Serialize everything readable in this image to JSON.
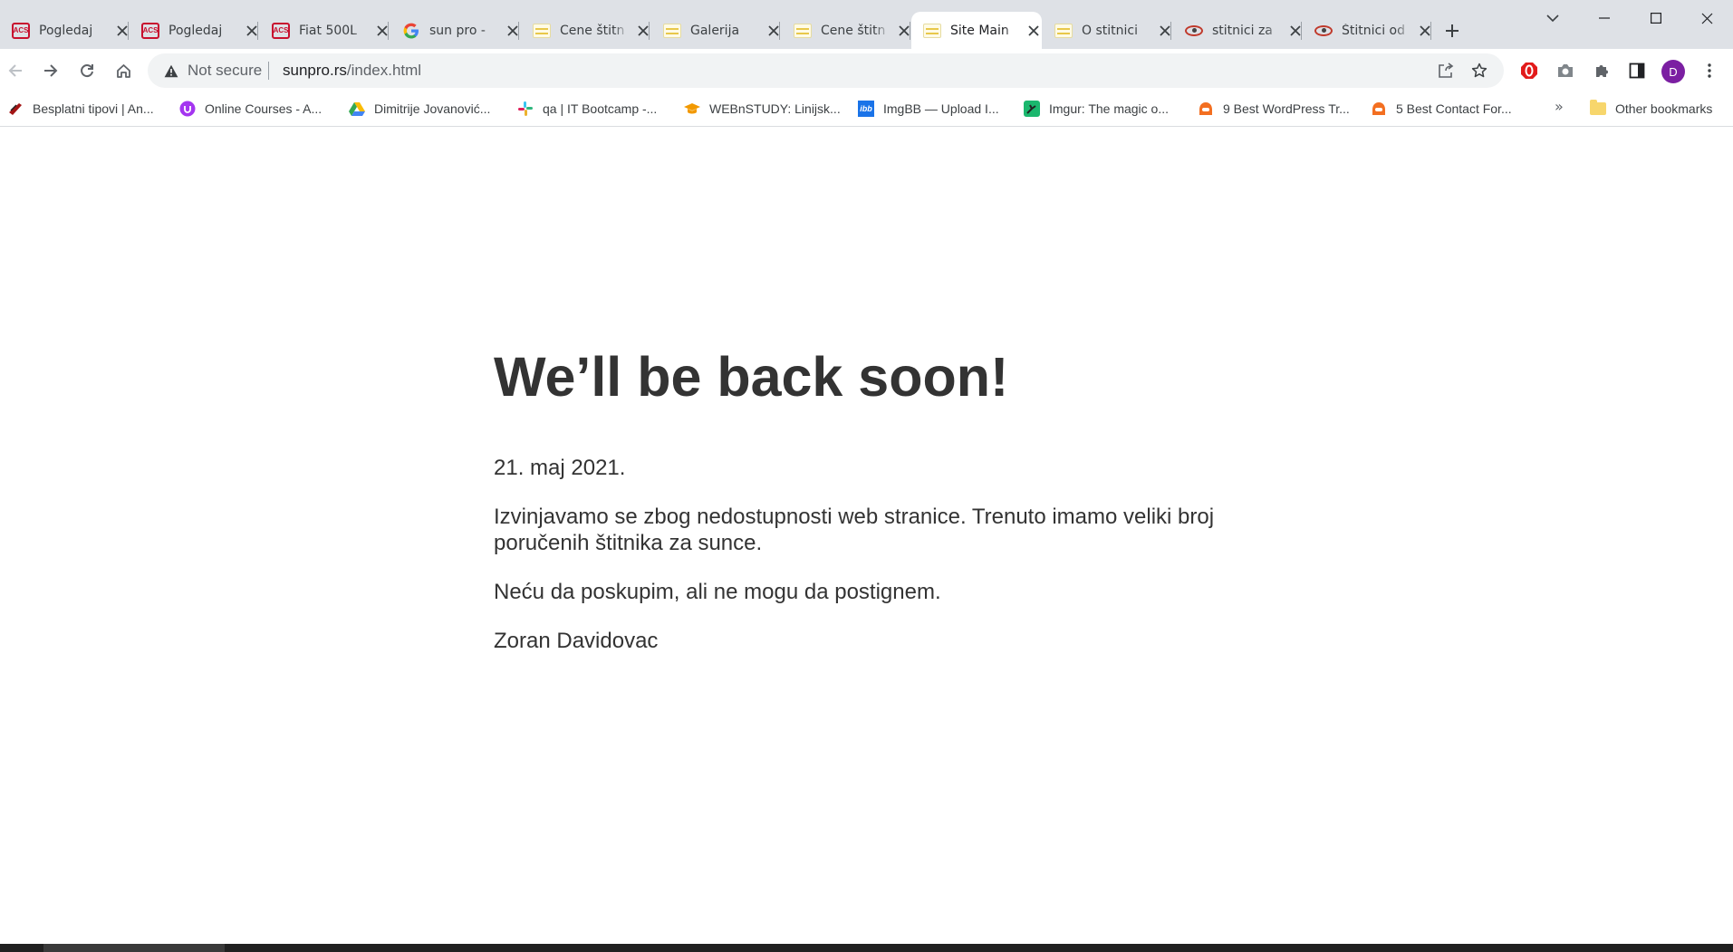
{
  "tabs": [
    {
      "title": "Pogledaj",
      "favicon": "acs-logo-icon"
    },
    {
      "title": "Pogledaj",
      "favicon": "acs-logo-icon"
    },
    {
      "title": "Fiat 500L",
      "favicon": "acs-logo-icon"
    },
    {
      "title": "sun pro -",
      "favicon": "google-icon"
    },
    {
      "title": "Cene štitn",
      "favicon": "site-icon"
    },
    {
      "title": "Galerija",
      "favicon": "site-icon"
    },
    {
      "title": "Cene štitn",
      "favicon": "site-icon"
    },
    {
      "title": "Site Main",
      "favicon": "site-icon",
      "active": true
    },
    {
      "title": "O stitnici",
      "favicon": "site-icon"
    },
    {
      "title": "stitnici za",
      "favicon": "eye-icon"
    },
    {
      "title": "Štitnici od",
      "favicon": "eye-icon"
    }
  ],
  "omnibox": {
    "security_label": "Not secure",
    "host": "sunpro.rs",
    "path": "/index.html"
  },
  "profile": {
    "initial": "D",
    "color": "#7b1fa2"
  },
  "bookmarks": [
    {
      "label": "Besplatni tipovi | An...",
      "icon": "tipovi-icon"
    },
    {
      "label": "Online Courses - A...",
      "icon": "udemy-icon"
    },
    {
      "label": "Dimitrije Jovanović...",
      "icon": "google-drive-icon"
    },
    {
      "label": "qa | IT Bootcamp -...",
      "icon": "slack-icon"
    },
    {
      "label": "WEBnSTUDY: Linijsk...",
      "icon": "graduation-cap-icon"
    },
    {
      "label": "ImgBB — Upload I...",
      "icon": "imgbb-icon"
    },
    {
      "label": "Imgur: The magic o...",
      "icon": "imgur-icon"
    },
    {
      "label": "9 Best WordPress Tr...",
      "icon": "wpbeginner-icon"
    },
    {
      "label": "5 Best Contact For...",
      "icon": "wpbeginner-icon"
    }
  ],
  "bookmarks_overflow": "»",
  "other_bookmarks": "Other bookmarks",
  "page": {
    "heading": "We’ll be back soon!",
    "date": "21. maj 2021.",
    "message": "Izvinjavamo se zbog nedostupnosti web stranice. Trenuto imamo veliki broj poručenih štitnika za sunce.",
    "note": "Neću da poskupim, ali ne mogu da postignem.",
    "signature": "Zoran Davidovac"
  }
}
